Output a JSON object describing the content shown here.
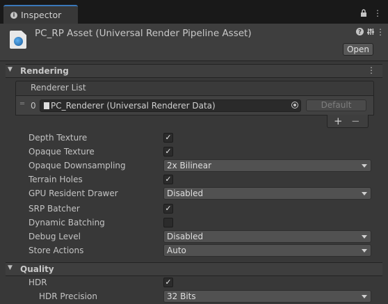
{
  "tab": {
    "label": "Inspector"
  },
  "header": {
    "title": "PC_RP Asset (Universal Render Pipeline Asset)",
    "open_label": "Open"
  },
  "sections": {
    "rendering": "Rendering",
    "quality": "Quality"
  },
  "renderer_list": {
    "header": "Renderer List",
    "index": "0",
    "value": "PC_Renderer (Universal Renderer Data)",
    "default_label": "Default",
    "add": "+",
    "remove": "−"
  },
  "rendering_rows": {
    "depth_texture": {
      "label": "Depth Texture",
      "checked": true
    },
    "opaque_texture": {
      "label": "Opaque Texture",
      "checked": true
    },
    "opaque_downsampling": {
      "label": "Opaque Downsampling",
      "value": "2x Bilinear"
    },
    "terrain_holes": {
      "label": "Terrain Holes",
      "checked": true
    },
    "gpu_resident_drawer": {
      "label": "GPU Resident Drawer",
      "value": "Disabled"
    },
    "srp_batcher": {
      "label": "SRP Batcher",
      "checked": true
    },
    "dynamic_batching": {
      "label": "Dynamic Batching",
      "checked": false
    },
    "debug_level": {
      "label": "Debug Level",
      "value": "Disabled"
    },
    "store_actions": {
      "label": "Store Actions",
      "value": "Auto"
    }
  },
  "quality_rows": {
    "hdr": {
      "label": "HDR",
      "checked": true
    },
    "hdr_precision": {
      "label": "HDR Precision",
      "value": "32 Bits"
    }
  },
  "glyphs": {
    "check": "✓",
    "kebab": "⋮",
    "lock": "🔒",
    "help": "?",
    "sliders": "⚙"
  },
  "colors": {
    "accent": "#3a79bb",
    "panel": "#383838",
    "header": "#3e3e3e"
  }
}
